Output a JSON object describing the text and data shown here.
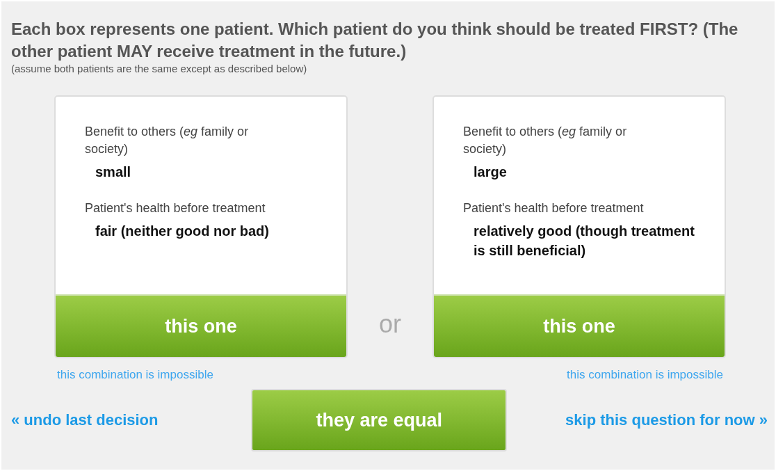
{
  "question": {
    "title": "Each box represents one patient. Which patient do you think should be treated FIRST? (The other patient MAY receive treatment in the future.)",
    "note": "(assume both patients are the same except as described below)"
  },
  "patients": [
    {
      "attributes": [
        {
          "label": "Benefit to others (*eg* family or society)",
          "value": "small"
        },
        {
          "label": "Patient's health before treatment",
          "value": "fair (neither good nor bad)"
        }
      ],
      "choose_button": "this one",
      "impossible_link": "this combination is impossible"
    },
    {
      "attributes": [
        {
          "label": "Benefit to others (*eg* family or society)",
          "value": "large"
        },
        {
          "label": "Patient's health before treatment",
          "value": "relatively good (though treatment is still beneficial)"
        }
      ],
      "choose_button": "this one",
      "impossible_link": "this combination is impossible"
    }
  ],
  "separator": "or",
  "undo_link": "« undo last decision",
  "equal_button": "they are equal",
  "skip_link": "skip this question for now »"
}
